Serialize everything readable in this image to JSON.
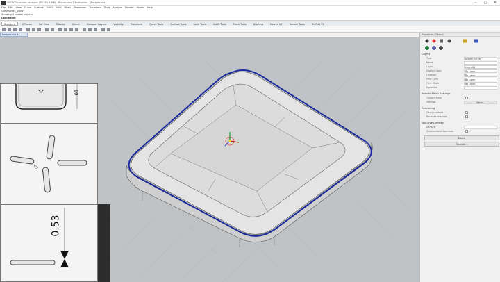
{
  "window": {
    "title": "AB1603 cushion example (3D FFA 8 MB) - Rhinoceros 7 Evaluation - [Perspective]",
    "min": "–",
    "max": "□",
    "close": "✕"
  },
  "menu": [
    "File",
    "Edit",
    "View",
    "Curve",
    "Surface",
    "SubD",
    "Solid",
    "Mesh",
    "Dimension",
    "Transform",
    "Tools",
    "Analyze",
    "Render",
    "Panels",
    "Help"
  ],
  "command": {
    "history1": "Command: _Show",
    "history2": "Showing 4 hidden objects.",
    "prompt": "Command:"
  },
  "tabs": [
    "Standard",
    "CPlanes",
    "Set View",
    "Display",
    "Select",
    "Viewport Layout",
    "Visibility",
    "Transform",
    "Curve Tools",
    "Surface Tools",
    "Solid Tools",
    "SubD Tools",
    "Mesh Tools",
    "Drafting",
    "New in V7",
    "Render Tools",
    "RhiFlat V4"
  ],
  "viewport": {
    "tab_label": "Perspective ▾",
    "top_dim": "10",
    "side_dim": "0.53"
  },
  "properties": {
    "header": "Properties: Object",
    "section_object": "Object",
    "rows": [
      {
        "label": "Type",
        "value": "8 open curves"
      },
      {
        "label": "Name",
        "value": ""
      },
      {
        "label": "Layer",
        "value": "Layer 01"
      },
      {
        "label": "Display Color",
        "value": "By Layer"
      },
      {
        "label": "Linetype",
        "value": "By Layer"
      },
      {
        "label": "Print Color",
        "value": "By Layer"
      },
      {
        "label": "Print Width",
        "value": "By Layer"
      },
      {
        "label": "Hyperlink",
        "value": ""
      }
    ],
    "section_render_mesh": "Render Mesh Settings",
    "custom_mesh": "Custom Mesh",
    "settings_label": "Settings",
    "adjust_button": "Adjust...",
    "section_rendering": "Rendering",
    "casts_shadows": "Casts shadows",
    "receives_shadows": "Receives shadows",
    "section_isocurve": "Isocurve Density",
    "density": "Density",
    "show_surface_isocurves": "Show surface isocurves",
    "match_button": "Match",
    "details_button": "Details..."
  },
  "colors": {
    "accent": "#1a2a9c",
    "viewport_bg": "#bfc3c6",
    "surface": "#e8e8e8"
  }
}
